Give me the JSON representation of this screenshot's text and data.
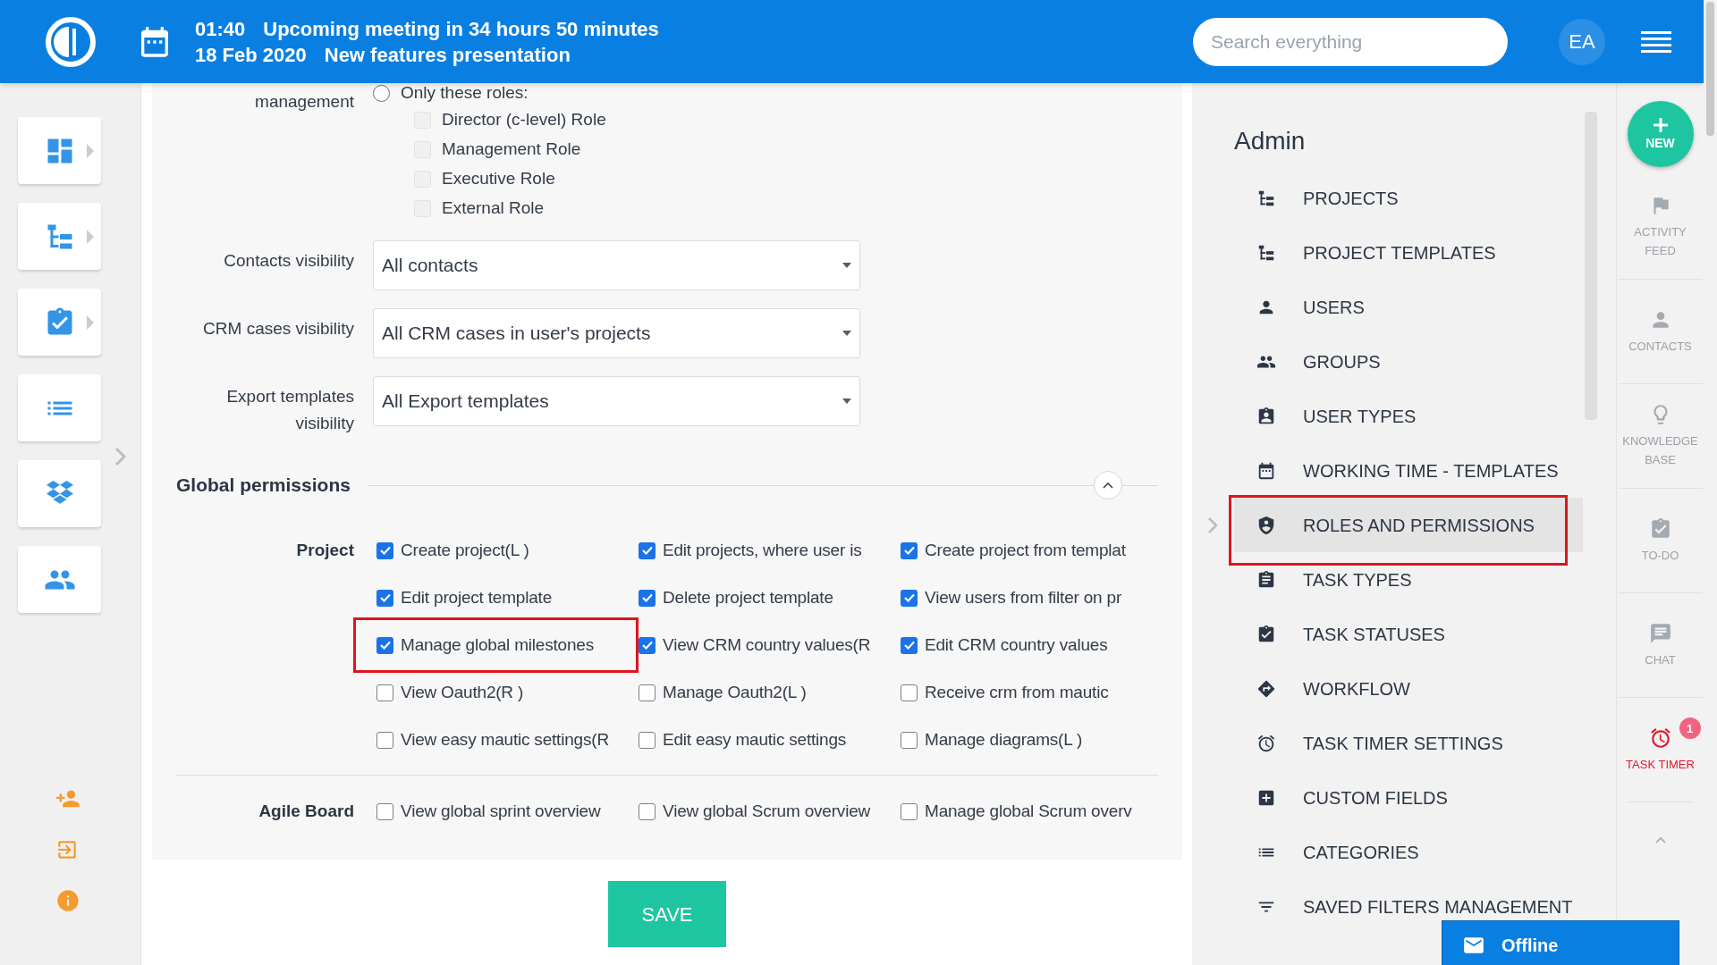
{
  "top_bar": {
    "meeting_time": "01:40",
    "meeting_title": "Upcoming meeting in 34 hours 50 minutes",
    "meeting_date": "18 Feb 2020",
    "meeting_subject": "New features presentation",
    "search": {
      "placeholder": "Search everything"
    },
    "avatar": "EA"
  },
  "form": {
    "role_scope": {
      "label": "management",
      "option": {
        "label": "Only these roles:",
        "selected": false
      },
      "roles": [
        {
          "label": "Director (c-level) Role",
          "checked": false
        },
        {
          "label": "Management Role",
          "checked": false
        },
        {
          "label": "Executive Role",
          "checked": false
        },
        {
          "label": "External Role",
          "checked": false
        }
      ]
    },
    "selects": [
      {
        "label": "Contacts visibility",
        "value": "All contacts"
      },
      {
        "label": "CRM cases visibility",
        "value": "All CRM cases in user's projects"
      },
      {
        "label": "Export templates visibility",
        "value": "All Export templates"
      }
    ],
    "global_permissions": {
      "title": "Global permissions",
      "expanded": true,
      "groups": [
        {
          "label": "Project",
          "permissions": [
            {
              "label": "Create project(L )",
              "checked": true,
              "highlighted": false
            },
            {
              "label": "Edit projects, where user is",
              "checked": true,
              "highlighted": false
            },
            {
              "label": "Create project from templat",
              "checked": true,
              "highlighted": false
            },
            {
              "label": "Edit project template",
              "checked": true,
              "highlighted": false
            },
            {
              "label": "Delete project template",
              "checked": true,
              "highlighted": false
            },
            {
              "label": "View users from filter on pr",
              "checked": true,
              "highlighted": false
            },
            {
              "label": "Manage global milestones",
              "checked": true,
              "highlighted": true
            },
            {
              "label": "View CRM country values(R",
              "checked": true,
              "highlighted": false
            },
            {
              "label": "Edit CRM country values",
              "checked": true,
              "highlighted": false
            },
            {
              "label": "View Oauth2(R )",
              "checked": false,
              "highlighted": false
            },
            {
              "label": "Manage Oauth2(L )",
              "checked": false,
              "highlighted": false
            },
            {
              "label": "Receive crm from mautic",
              "checked": false,
              "highlighted": false
            },
            {
              "label": "View easy mautic settings(R",
              "checked": false,
              "highlighted": false
            },
            {
              "label": "Edit easy mautic settings",
              "checked": false,
              "highlighted": false
            },
            {
              "label": "Manage diagrams(L )",
              "checked": false,
              "highlighted": false
            }
          ]
        },
        {
          "label": "Agile Board",
          "permissions": [
            {
              "label": "View global sprint overview",
              "checked": false,
              "highlighted": false
            },
            {
              "label": "View global Scrum overview",
              "checked": false,
              "highlighted": false
            },
            {
              "label": "Manage global Scrum overv",
              "checked": false,
              "highlighted": false
            }
          ]
        }
      ]
    },
    "save_button": "SAVE"
  },
  "admin_menu": {
    "title": "Admin",
    "items": [
      {
        "label": "PROJECTS",
        "selected": false,
        "highlighted": false
      },
      {
        "label": "PROJECT TEMPLATES",
        "selected": false,
        "highlighted": false
      },
      {
        "label": "USERS",
        "selected": false,
        "highlighted": false
      },
      {
        "label": "GROUPS",
        "selected": false,
        "highlighted": false
      },
      {
        "label": "USER TYPES",
        "selected": false,
        "highlighted": false
      },
      {
        "label": "WORKING TIME - TEMPLATES",
        "selected": false,
        "highlighted": false
      },
      {
        "label": "ROLES AND PERMISSIONS",
        "selected": true,
        "highlighted": true
      },
      {
        "label": "TASK TYPES",
        "selected": false,
        "highlighted": false
      },
      {
        "label": "TASK STATUSES",
        "selected": false,
        "highlighted": false
      },
      {
        "label": "WORKFLOW",
        "selected": false,
        "highlighted": false
      },
      {
        "label": "TASK TIMER SETTINGS",
        "selected": false,
        "highlighted": false
      },
      {
        "label": "CUSTOM FIELDS",
        "selected": false,
        "highlighted": false
      },
      {
        "label": "CATEGORIES",
        "selected": false,
        "highlighted": false
      },
      {
        "label": "SAVED FILTERS MANAGEMENT",
        "selected": false,
        "highlighted": false
      }
    ]
  },
  "right_rail": {
    "new_button": "NEW",
    "items": [
      {
        "label": "ACTIVITY FEED",
        "active": false
      },
      {
        "label": "CONTACTS",
        "active": false
      },
      {
        "label": "KNOWLEDGE BASE",
        "active": false
      },
      {
        "label": "TO-DO",
        "active": false
      },
      {
        "label": "CHAT",
        "active": false
      },
      {
        "label": "TASK TIMER",
        "active": true,
        "badge": "1"
      }
    ]
  },
  "chat_status": "Offline"
}
